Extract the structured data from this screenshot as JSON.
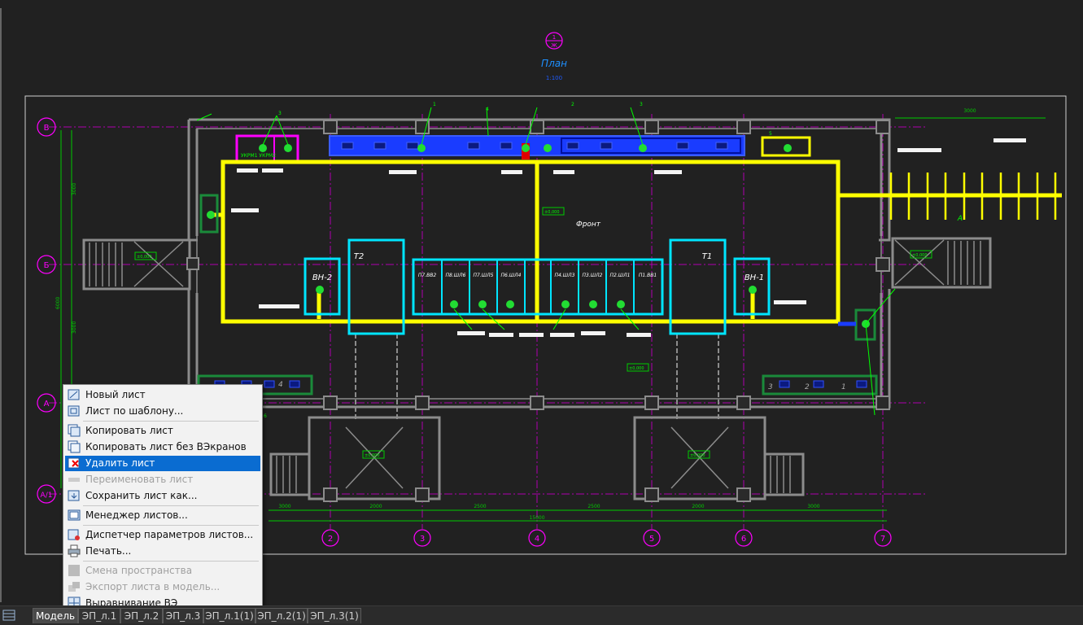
{
  "drawing": {
    "view_symbol": {
      "top": "1",
      "bottom": "Ж"
    },
    "title": "План",
    "subtitle": "1:100",
    "axes_letters": [
      "В",
      "Б",
      "А",
      "А/1"
    ],
    "axes_numbers": [
      "2",
      "3",
      "4",
      "5",
      "6",
      "7"
    ],
    "rooms": {
      "t1": "Т1",
      "t2": "Т2",
      "vn1": "ВН-1",
      "vn2": "ВН-2",
      "front": "Фронт",
      "a": "А"
    },
    "cabinets": [
      "П7.ВВ2",
      "П8.ШЛ6",
      "П7.ШЛ5",
      "П6.ШЛ4",
      "П4.ШЛ3",
      "П3.ШЛ2",
      "П2.ШЛ1",
      "П1.ВВ1"
    ],
    "switchboards": {
      "left": "УКРМ1   УКРМ2",
      "bottom_left": [
        "",
        "",
        "4"
      ],
      "bottom_right": [
        "3",
        "2",
        "1"
      ]
    },
    "callouts": [
      "1",
      "2",
      "3",
      "4",
      "5",
      "6"
    ],
    "levels": [
      "±0,000",
      "±0,000",
      "±0,000",
      "±0,000",
      "±0,000",
      "±0,000"
    ],
    "dimensions": [
      "3000",
      "2000",
      "2500",
      "2500",
      "2000",
      "3000",
      "15000"
    ],
    "side_dims": [
      "3000",
      "3000",
      "6000",
      "3000"
    ]
  },
  "tabs": [
    {
      "label": "Модель",
      "active": true
    },
    {
      "label": "ЭП_л.1"
    },
    {
      "label": "ЭП_л.2"
    },
    {
      "label": "ЭП_л.3"
    },
    {
      "label": "ЭП_л.1(1)"
    },
    {
      "label": "ЭП_л.2(1)"
    },
    {
      "label": "ЭП_л.3(1)"
    }
  ],
  "context_menu": {
    "items": [
      {
        "label": "Новый лист",
        "icon": "new-sheet-icon"
      },
      {
        "label": "Лист по шаблону...",
        "icon": "template-sheet-icon"
      },
      {
        "label": "Копировать лист",
        "icon": "copy-sheet-icon"
      },
      {
        "label": "Копировать лист без ВЭкранов",
        "icon": "copy-sheet-nov-icon"
      },
      {
        "label": "Удалить лист",
        "icon": "delete-sheet-icon",
        "selected": true
      },
      {
        "label": "Переименовать лист",
        "icon": "rename-sheet-icon",
        "disabled": true
      },
      {
        "label": "Сохранить лист как...",
        "icon": "save-sheet-icon"
      },
      {
        "label": "Менеджер листов...",
        "icon": "sheet-manager-icon"
      },
      {
        "label": "Диспетчер параметров листов...",
        "icon": "page-setup-icon"
      },
      {
        "label": "Печать...",
        "icon": "print-icon"
      },
      {
        "label": "Смена пространства",
        "icon": "change-space-icon",
        "disabled": true
      },
      {
        "label": "Экспорт листа в модель...",
        "icon": "export-sheet-icon",
        "disabled": true
      },
      {
        "label": "Выравнивание ВЭ",
        "icon": "align-viewports-icon"
      }
    ]
  },
  "colors": {
    "background": "#212121",
    "wall": "#8c8c8c",
    "cable": "#ffff00",
    "equipment": "#00e5ff",
    "axis": "#ff00ff",
    "leader": "#00ff00",
    "blue_panel": "#1a3cff",
    "menu_highlight": "#0a6cd1"
  }
}
